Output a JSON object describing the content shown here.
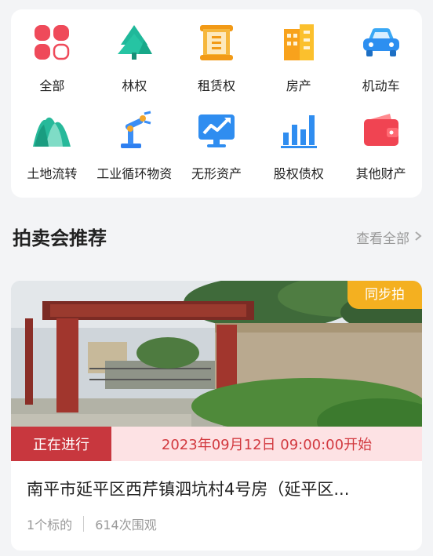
{
  "categories": [
    {
      "label": "全部",
      "icon": "all-grid-icon"
    },
    {
      "label": "林权",
      "icon": "forest-icon"
    },
    {
      "label": "租赁权",
      "icon": "lease-scroll-icon"
    },
    {
      "label": "房产",
      "icon": "building-icon"
    },
    {
      "label": "机动车",
      "icon": "car-icon"
    },
    {
      "label": "土地流转",
      "icon": "land-mountain-icon"
    },
    {
      "label": "工业循环物资",
      "icon": "robot-arm-icon"
    },
    {
      "label": "无形资产",
      "icon": "trend-monitor-icon"
    },
    {
      "label": "股权债权",
      "icon": "bar-chart-icon"
    },
    {
      "label": "其他财产",
      "icon": "wallet-icon"
    }
  ],
  "section": {
    "title": "拍卖会推荐",
    "view_all": "查看全部"
  },
  "auction": {
    "badge": "同步拍",
    "status": "正在进行",
    "start_time": "2023年09月12日 09:00:00开始",
    "title": "南平市延平区西芹镇泗坑村4号房（延平区...",
    "lots": "1个标的",
    "views": "614次围观"
  },
  "colors": {
    "accent_red": "#c8373e",
    "badge_orange": "#f4b020"
  }
}
